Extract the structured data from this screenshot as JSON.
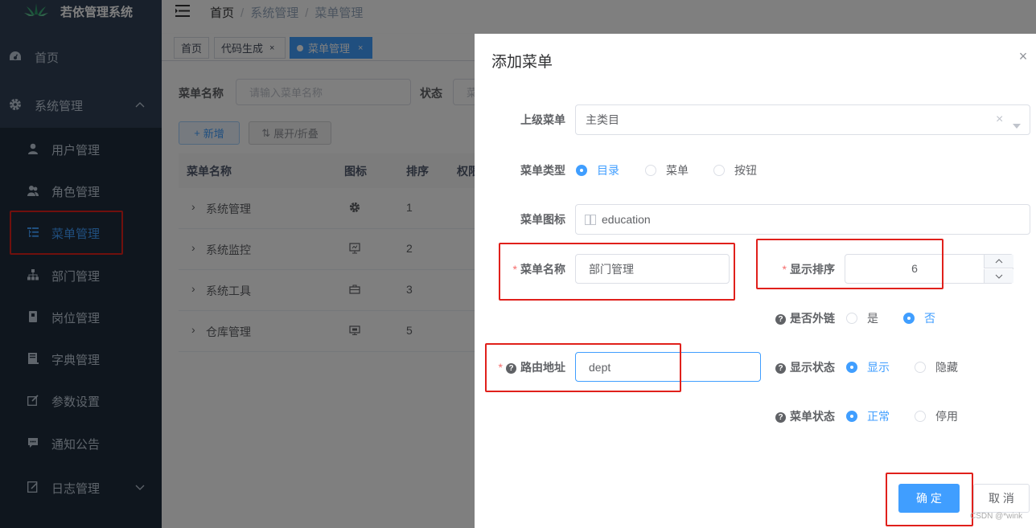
{
  "app": {
    "title": "若依管理系统"
  },
  "sidebar": {
    "items": [
      {
        "label": "首页",
        "icon": "dashboard-icon"
      },
      {
        "label": "系统管理",
        "icon": "gear-icon"
      },
      {
        "label": "用户管理",
        "icon": "user-icon"
      },
      {
        "label": "角色管理",
        "icon": "peoples-icon"
      },
      {
        "label": "菜单管理",
        "icon": "tree-table-icon"
      },
      {
        "label": "部门管理",
        "icon": "tree-icon"
      },
      {
        "label": "岗位管理",
        "icon": "post-icon"
      },
      {
        "label": "字典管理",
        "icon": "dict-icon"
      },
      {
        "label": "参数设置",
        "icon": "edit-icon"
      },
      {
        "label": "通知公告",
        "icon": "message-icon"
      },
      {
        "label": "日志管理",
        "icon": "log-icon"
      }
    ]
  },
  "breadcrumb": [
    "首页",
    "系统管理",
    "菜单管理"
  ],
  "tags": [
    {
      "label": "首页"
    },
    {
      "label": "代码生成"
    },
    {
      "label": "菜单管理"
    }
  ],
  "search": {
    "name_label": "菜单名称",
    "name_placeholder": "请输入菜单名称",
    "status_label": "状态",
    "status_value": "菜"
  },
  "toolbar": {
    "add": "新增",
    "expand": "展开/折叠"
  },
  "table": {
    "columns": [
      "菜单名称",
      "图标",
      "排序",
      "权限"
    ],
    "rows": [
      {
        "name": "系统管理",
        "sort": "1",
        "icon": "gear-icon"
      },
      {
        "name": "系统监控",
        "sort": "2",
        "icon": "monitor-icon"
      },
      {
        "name": "系统工具",
        "sort": "3",
        "icon": "tool-icon"
      },
      {
        "name": "仓库管理",
        "sort": "5",
        "icon": "screen-icon"
      }
    ]
  },
  "dialog": {
    "title": "添加菜单",
    "parent_label": "上级菜单",
    "parent_value": "主类目",
    "type_label": "菜单类型",
    "type_options": [
      "目录",
      "菜单",
      "按钮"
    ],
    "type_selected": "目录",
    "icon_label": "菜单图标",
    "icon_value": "education",
    "name_label": "菜单名称",
    "name_value": "部门管理",
    "order_label": "显示排序",
    "order_value": "6",
    "frame_label": "是否外链",
    "frame_options": [
      "是",
      "否"
    ],
    "frame_selected": "否",
    "path_label": "路由地址",
    "path_value": "dept",
    "visible_label": "显示状态",
    "visible_options": [
      "显示",
      "隐藏"
    ],
    "visible_selected": "显示",
    "status_label": "菜单状态",
    "status_options": [
      "正常",
      "停用"
    ],
    "status_selected": "正常",
    "ok_label": "确 定",
    "cancel_label": "取 消"
  },
  "watermark": "CSDN @*wink",
  "colors": {
    "primary": "#409eff",
    "sidebar": "#304156",
    "highlight": "#e0201b"
  }
}
